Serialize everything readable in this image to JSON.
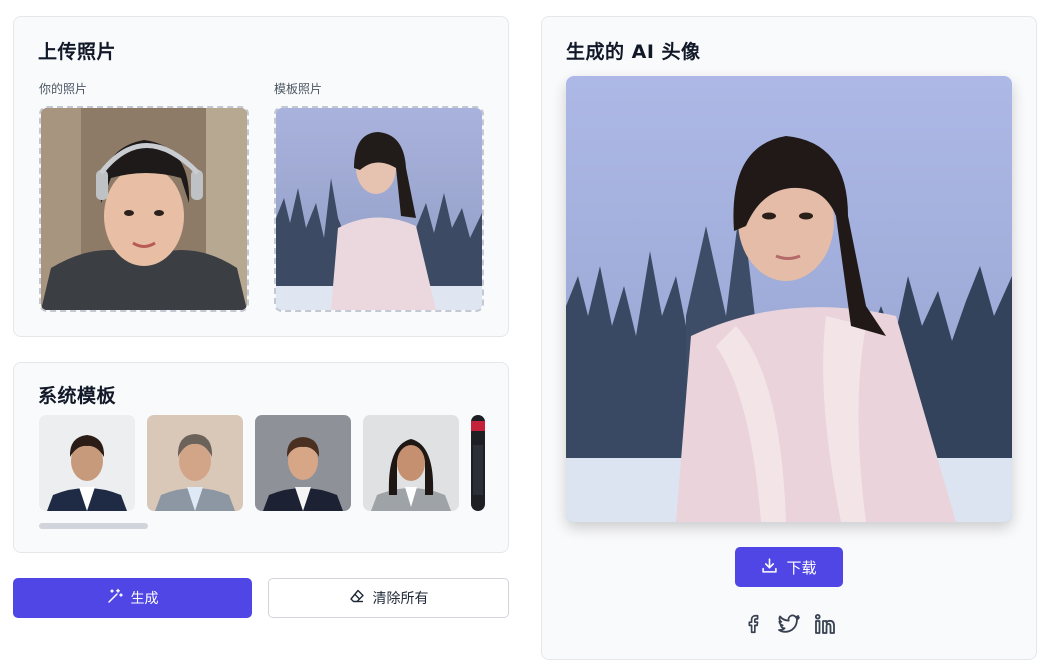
{
  "upload": {
    "title": "上传照片",
    "your_photo_label": "你的照片",
    "template_photo_label": "模板照片"
  },
  "templates": {
    "title": "系统模板",
    "items": [
      "template-1",
      "template-2",
      "template-3",
      "template-4",
      "template-5"
    ]
  },
  "actions": {
    "generate_label": "生成",
    "clear_label": "清除所有"
  },
  "result": {
    "title": "生成的 AI 头像",
    "download_label": "下载"
  },
  "share": {
    "icons": [
      "facebook-icon",
      "twitter-icon",
      "linkedin-icon"
    ]
  },
  "colors": {
    "primary": "#4f46e5",
    "card_bg": "#f9fafb",
    "border": "#e5e7eb",
    "dashed_border": "#c3c8d2"
  }
}
